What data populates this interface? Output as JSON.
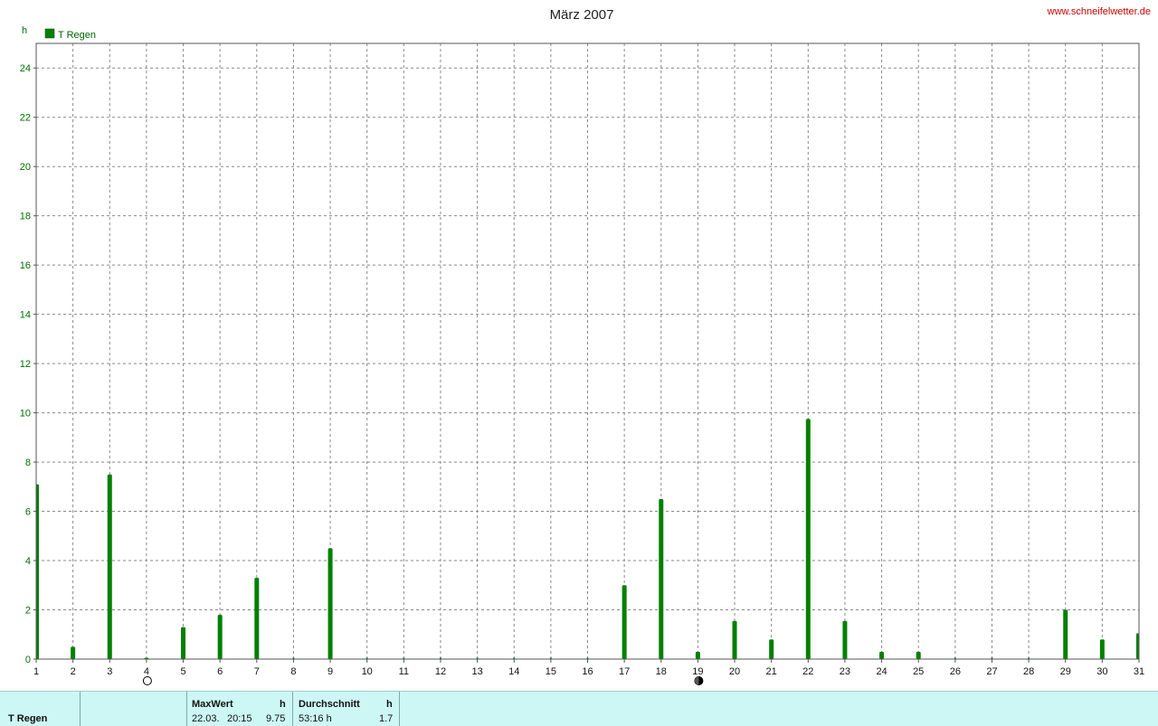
{
  "header": {
    "site": "www.schneifelwetter.de"
  },
  "chart_data": {
    "type": "bar",
    "title": "März 2007",
    "ylabel": "h",
    "ylim": [
      0,
      25
    ],
    "yticks": [
      0,
      2,
      4,
      6,
      8,
      10,
      12,
      14,
      16,
      18,
      20,
      22,
      24
    ],
    "grid": true,
    "legend_position": "top-left",
    "categories": [
      "1",
      "2",
      "3",
      "4",
      "5",
      "6",
      "7",
      "8",
      "9",
      "10",
      "11",
      "12",
      "13",
      "14",
      "15",
      "16",
      "17",
      "18",
      "19",
      "20",
      "21",
      "22",
      "23",
      "24",
      "25",
      "26",
      "27",
      "28",
      "29",
      "30",
      "31"
    ],
    "series": [
      {
        "name": "T Regen",
        "color": "#008000",
        "values": [
          7.1,
          0.5,
          7.5,
          0.05,
          1.3,
          1.8,
          3.3,
          0,
          4.5,
          0,
          0,
          0,
          0,
          0,
          0,
          0,
          3.0,
          6.5,
          0.3,
          1.55,
          0.8,
          9.75,
          1.55,
          0.3,
          0.3,
          0,
          0,
          0,
          2.0,
          0.8,
          1.05
        ]
      }
    ],
    "moon_phases": [
      {
        "day": 4,
        "phase": "full-moon-icon"
      },
      {
        "day": 19,
        "phase": "new-moon-icon"
      }
    ]
  },
  "footer": {
    "series_label": "T Regen",
    "max_header": "MaxWert",
    "max_unit": "h",
    "max_date": "22.03.",
    "max_time": "20:15",
    "max_value": "9.75",
    "avg_header": "Durchschnitt",
    "avg_unit": "h",
    "avg_total": "53:16 h",
    "avg_value": "1.7"
  }
}
